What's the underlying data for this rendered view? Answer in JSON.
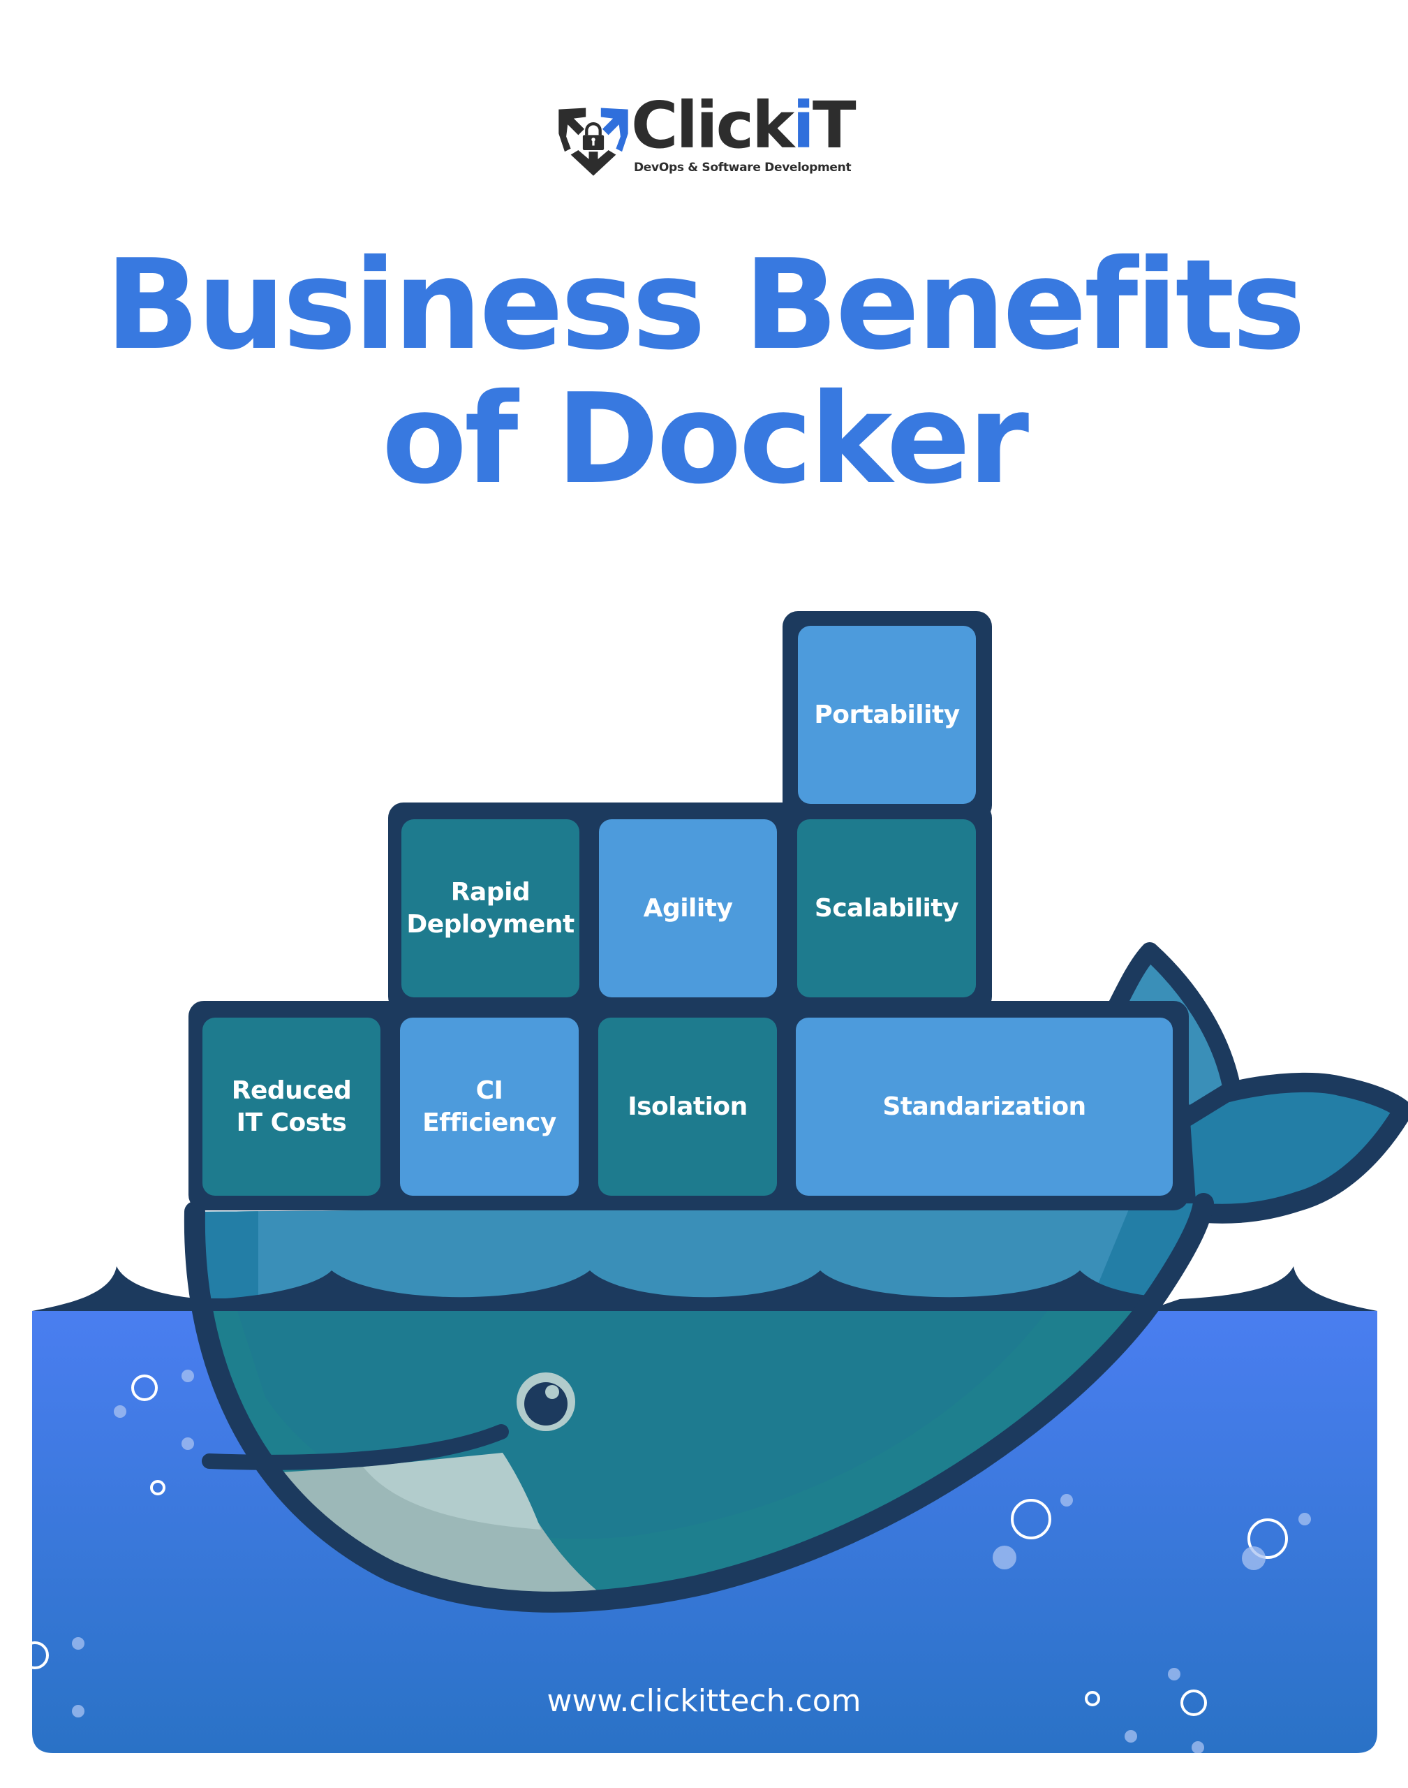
{
  "brand": {
    "name_prefix": "Click",
    "name_accent": "i",
    "name_suffix": "T",
    "tagline": "DevOps & Software Development",
    "logo_icon": "shield-lock-arrows-icon"
  },
  "title": {
    "line1": "Business Benefits",
    "line2": "of Docker"
  },
  "containers": {
    "top": [
      {
        "label": "Portability",
        "style": "light"
      }
    ],
    "middle": [
      {
        "label": "Rapid\nDeployment",
        "style": "teal"
      },
      {
        "label": "Agility",
        "style": "light"
      },
      {
        "label": "Scalability",
        "style": "teal"
      }
    ],
    "bottom": [
      {
        "label": "Reduced\nIT Costs",
        "style": "teal"
      },
      {
        "label": "CI\nEfficiency",
        "style": "light"
      },
      {
        "label": "Isolation",
        "style": "teal"
      },
      {
        "label": "Standarization",
        "style": "light"
      }
    ]
  },
  "illustration": {
    "subject": "docker-whale-icon",
    "bubbles": "bubble-icons"
  },
  "footer": {
    "url": "www.clickittech.com"
  },
  "colors": {
    "title_blue": "#3879E0",
    "navy_outline": "#1C3A5E",
    "container_light": "#4D9BDC",
    "container_teal": "#1E7B8E",
    "whale_upper": "#3A8FB8",
    "whale_lower": "#1E7F8E",
    "whale_belly": "#9CB8B8",
    "water_top": "#4A7EF0",
    "water_bottom": "#2C72C6",
    "logo_dark": "#2D2D2D",
    "logo_blue": "#2F6FDC"
  }
}
